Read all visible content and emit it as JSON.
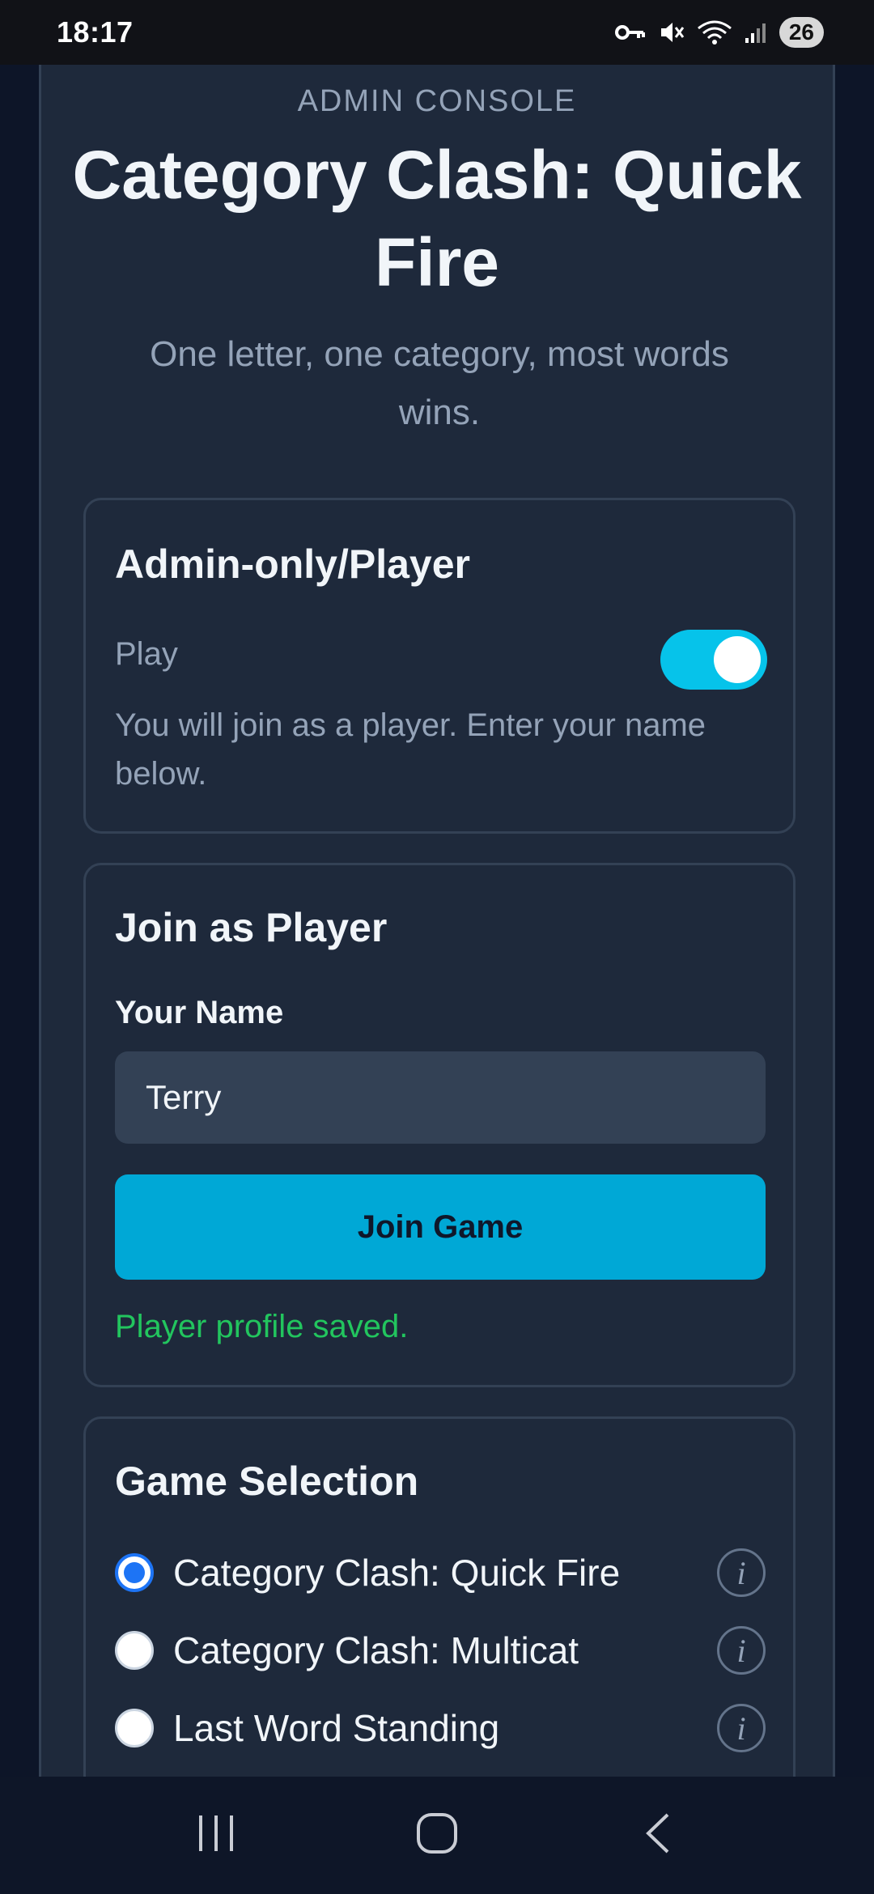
{
  "status_bar": {
    "time": "18:17",
    "battery": "26",
    "icons": [
      "vpn-key-icon",
      "mute-icon",
      "wifi-icon",
      "signal-icon"
    ]
  },
  "header": {
    "eyebrow": "ADMIN CONSOLE",
    "title": "Category Clash: Quick Fire",
    "subtitle": "One letter, one category, most words wins."
  },
  "mode_card": {
    "heading": "Admin-only/Player",
    "toggle_label": "Play",
    "toggle_on": true,
    "help_text": "You will join as a player. Enter your name below."
  },
  "join_card": {
    "heading": "Join as Player",
    "name_label": "Your Name",
    "name_value": "Terry",
    "join_button": "Join Game",
    "status_message": "Player profile saved."
  },
  "game_card": {
    "heading": "Game Selection",
    "options": [
      {
        "label": "Category Clash: Quick Fire",
        "selected": true
      },
      {
        "label": "Category Clash: Multicat",
        "selected": false
      },
      {
        "label": "Last Word Standing",
        "selected": false
      }
    ],
    "info_glyph": "i"
  },
  "colors": {
    "accent": "#06c3ea",
    "button": "#00a8d6",
    "success": "#22c55e",
    "radio_selected": "#1d74f5"
  }
}
